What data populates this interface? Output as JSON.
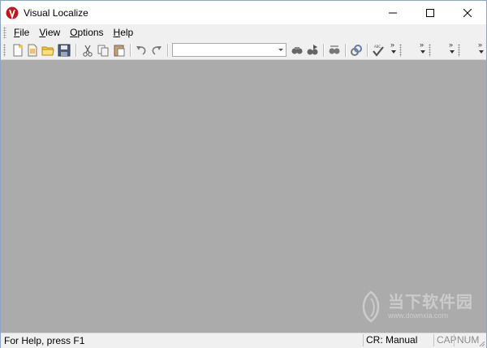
{
  "window": {
    "title": "Visual Localize",
    "accent": "#c4161c"
  },
  "menu": {
    "items": [
      {
        "key": "file",
        "accel": "F",
        "rest": "ile"
      },
      {
        "key": "view",
        "accel": "V",
        "rest": "iew"
      },
      {
        "key": "options",
        "accel": "O",
        "rest": "ptions"
      },
      {
        "key": "help",
        "accel": "H",
        "rest": "elp"
      }
    ]
  },
  "toolbar": {
    "buttons": [
      "new-icon",
      "open-icon",
      "folder-icon",
      "save-icon",
      "cut-icon",
      "copy-icon",
      "paste-icon",
      "undo-icon",
      "redo-icon",
      "find-icon",
      "find-next-icon",
      "replace-icon",
      "link-icon",
      "spellcheck-icon"
    ],
    "combo_value": ""
  },
  "workspace": {
    "background": "#ababab",
    "watermark": {
      "title": "当下软件园",
      "url": "www.downxia.com"
    }
  },
  "status": {
    "help": "For Help, press F1",
    "cr": "CR: Manual",
    "cap": "CAP",
    "num": "NUM"
  }
}
